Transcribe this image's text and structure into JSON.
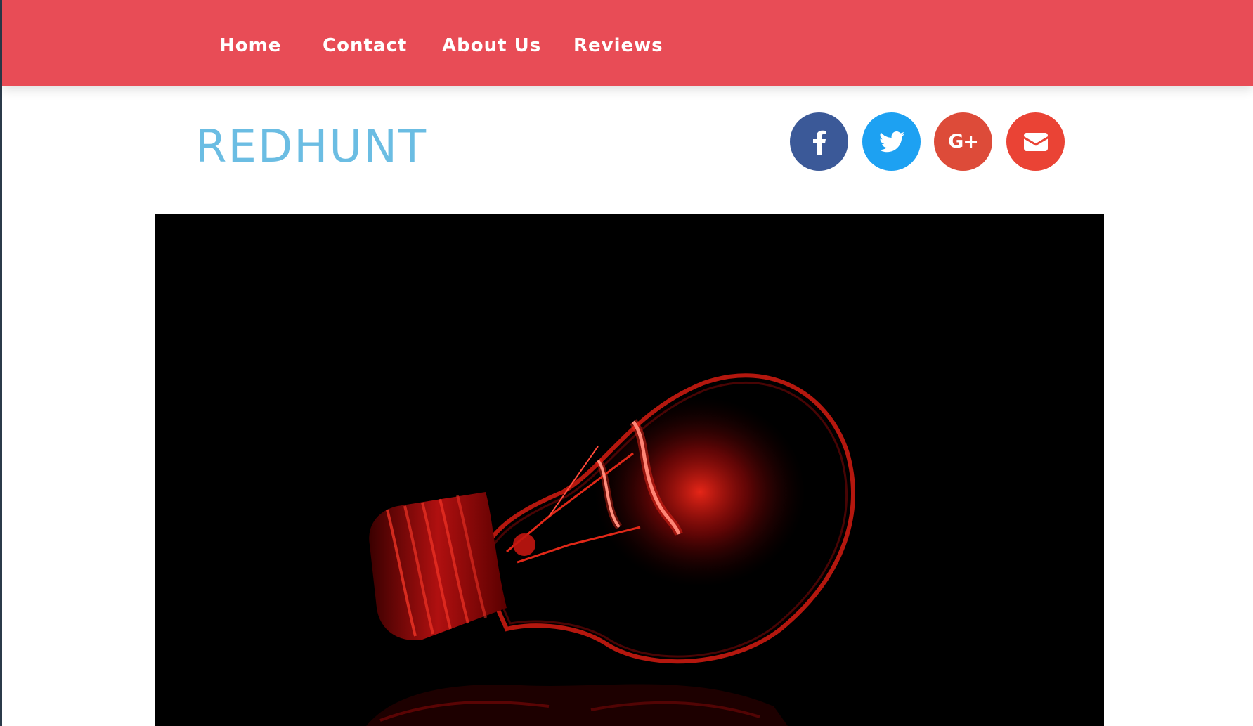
{
  "nav": {
    "items": [
      {
        "label": "Home"
      },
      {
        "label": "Contact"
      },
      {
        "label": "About Us"
      },
      {
        "label": "Reviews"
      }
    ]
  },
  "header": {
    "brand": "REDHUNT"
  },
  "social": [
    {
      "name": "facebook",
      "icon": "facebook-icon",
      "color": "#3b5998"
    },
    {
      "name": "twitter",
      "icon": "twitter-icon",
      "color": "#1da1f2"
    },
    {
      "name": "google-plus",
      "icon": "google-plus-icon",
      "color": "#dd4b39",
      "glyph": "G+"
    },
    {
      "name": "email",
      "icon": "envelope-icon",
      "color": "#ea4335"
    }
  ],
  "colors": {
    "navbar": "#e84c56",
    "brand": "#6bbde3"
  },
  "hero": {
    "subject": "red glowing light bulb"
  }
}
